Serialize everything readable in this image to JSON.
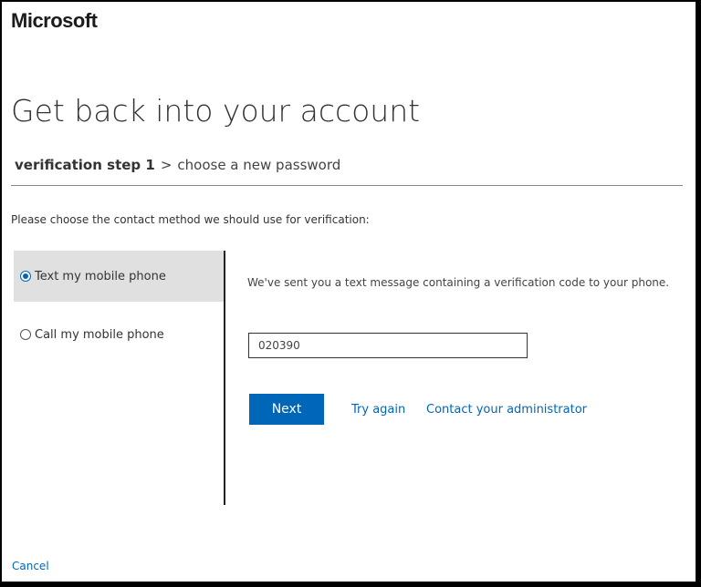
{
  "brand": {
    "logo_text": "Microsoft"
  },
  "page": {
    "title": "Get back into your account"
  },
  "breadcrumb": {
    "current": "verification step 1",
    "separator": ">",
    "next": "choose a new password"
  },
  "instruction": "Please choose the contact method we should use for verification:",
  "contact_methods": [
    {
      "label": "Text my mobile phone",
      "selected": true
    },
    {
      "label": "Call my mobile phone",
      "selected": false
    }
  ],
  "verification": {
    "message": "We've sent you a text message containing a verification code to your phone.",
    "code_value": "020390"
  },
  "actions": {
    "next_label": "Next",
    "try_again_label": "Try again",
    "contact_admin_label": "Contact your administrator",
    "cancel_label": "Cancel"
  },
  "colors": {
    "accent": "#0067b8",
    "selected_bg": "#e0e0e0"
  }
}
